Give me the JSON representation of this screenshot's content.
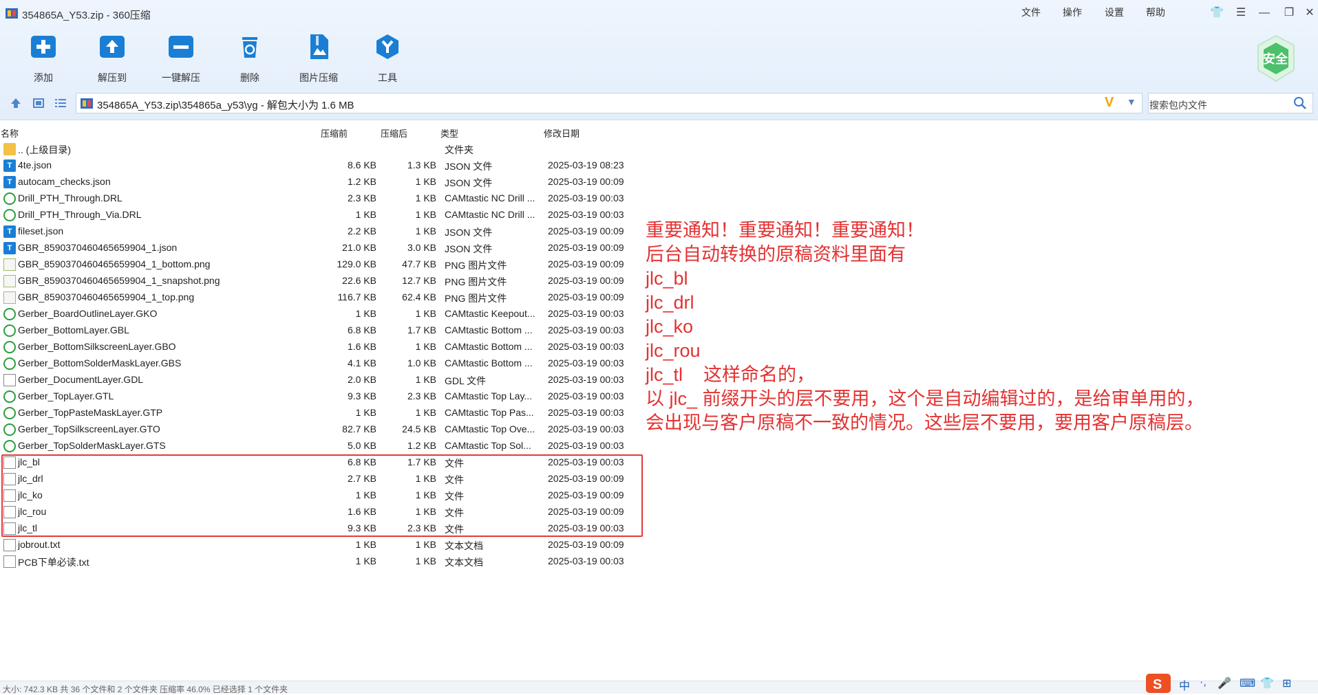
{
  "window": {
    "title": "354865A_Y53.zip - 360压缩",
    "menu": [
      "文件",
      "操作",
      "设置",
      "帮助"
    ]
  },
  "toolbar": {
    "items": [
      {
        "label": "添加",
        "icon": "add-icon"
      },
      {
        "label": "解压到",
        "icon": "extract-to-icon"
      },
      {
        "label": "一键解压",
        "icon": "one-click-extract-icon"
      },
      {
        "label": "删除",
        "icon": "delete-icon"
      },
      {
        "label": "图片压缩",
        "icon": "image-compress-icon"
      },
      {
        "label": "工具",
        "icon": "tools-icon"
      }
    ],
    "badge": "安全",
    "accent": "#1a7fd4"
  },
  "address": {
    "path": "354865A_Y53.zip\\354865a_y53\\yg - 解包大小为 1.6 MB",
    "search_placeholder": "搜索包内文件"
  },
  "columns": [
    "名称",
    "压缩前",
    "压缩后",
    "类型",
    "修改日期"
  ],
  "files": [
    {
      "name": ".. (上级目录)",
      "size": "",
      "packed": "",
      "type": "文件夹",
      "date": "",
      "icon": "folder"
    },
    {
      "name": "4te.json",
      "size": "8.6 KB",
      "packed": "1.3 KB",
      "type": "JSON 文件",
      "date": "2025-03-19 08:23",
      "icon": "json"
    },
    {
      "name": "autocam_checks.json",
      "size": "1.2 KB",
      "packed": "1 KB",
      "type": "JSON 文件",
      "date": "2025-03-19 00:09",
      "icon": "json"
    },
    {
      "name": "Drill_PTH_Through.DRL",
      "size": "2.3 KB",
      "packed": "1 KB",
      "type": "CAMtastic NC Drill ...",
      "date": "2025-03-19 00:03",
      "icon": "cam"
    },
    {
      "name": "Drill_PTH_Through_Via.DRL",
      "size": "1 KB",
      "packed": "1 KB",
      "type": "CAMtastic NC Drill ...",
      "date": "2025-03-19 00:03",
      "icon": "cam"
    },
    {
      "name": "fileset.json",
      "size": "2.2 KB",
      "packed": "1 KB",
      "type": "JSON 文件",
      "date": "2025-03-19 00:09",
      "icon": "json"
    },
    {
      "name": "GBR_8590370460465659904_1.json",
      "size": "21.0 KB",
      "packed": "3.0 KB",
      "type": "JSON 文件",
      "date": "2025-03-19 00:09",
      "icon": "json"
    },
    {
      "name": "GBR_8590370460465659904_1_bottom.png",
      "size": "129.0 KB",
      "packed": "47.7 KB",
      "type": "PNG 图片文件",
      "date": "2025-03-19 00:09",
      "icon": "png"
    },
    {
      "name": "GBR_8590370460465659904_1_snapshot.png",
      "size": "22.6 KB",
      "packed": "12.7 KB",
      "type": "PNG 图片文件",
      "date": "2025-03-19 00:09",
      "icon": "png"
    },
    {
      "name": "GBR_8590370460465659904_1_top.png",
      "size": "116.7 KB",
      "packed": "62.4 KB",
      "type": "PNG 图片文件",
      "date": "2025-03-19 00:09",
      "icon": "png"
    },
    {
      "name": "Gerber_BoardOutlineLayer.GKO",
      "size": "1 KB",
      "packed": "1 KB",
      "type": "CAMtastic Keepout...",
      "date": "2025-03-19 00:03",
      "icon": "cam"
    },
    {
      "name": "Gerber_BottomLayer.GBL",
      "size": "6.8 KB",
      "packed": "1.7 KB",
      "type": "CAMtastic Bottom ...",
      "date": "2025-03-19 00:03",
      "icon": "cam"
    },
    {
      "name": "Gerber_BottomSilkscreenLayer.GBO",
      "size": "1.6 KB",
      "packed": "1 KB",
      "type": "CAMtastic Bottom ...",
      "date": "2025-03-19 00:03",
      "icon": "cam"
    },
    {
      "name": "Gerber_BottomSolderMaskLayer.GBS",
      "size": "4.1 KB",
      "packed": "1.0 KB",
      "type": "CAMtastic Bottom ...",
      "date": "2025-03-19 00:03",
      "icon": "cam"
    },
    {
      "name": "Gerber_DocumentLayer.GDL",
      "size": "2.0 KB",
      "packed": "1 KB",
      "type": "GDL 文件",
      "date": "2025-03-19 00:03",
      "icon": "file"
    },
    {
      "name": "Gerber_TopLayer.GTL",
      "size": "9.3 KB",
      "packed": "2.3 KB",
      "type": "CAMtastic Top Lay...",
      "date": "2025-03-19 00:03",
      "icon": "cam"
    },
    {
      "name": "Gerber_TopPasteMaskLayer.GTP",
      "size": "1 KB",
      "packed": "1 KB",
      "type": "CAMtastic Top Pas...",
      "date": "2025-03-19 00:03",
      "icon": "cam"
    },
    {
      "name": "Gerber_TopSilkscreenLayer.GTO",
      "size": "82.7 KB",
      "packed": "24.5 KB",
      "type": "CAMtastic Top Ove...",
      "date": "2025-03-19 00:03",
      "icon": "cam"
    },
    {
      "name": "Gerber_TopSolderMaskLayer.GTS",
      "size": "5.0 KB",
      "packed": "1.2 KB",
      "type": "CAMtastic Top Sol...",
      "date": "2025-03-19 00:03",
      "icon": "cam"
    },
    {
      "name": "jlc_bl",
      "size": "6.8 KB",
      "packed": "1.7 KB",
      "type": "文件",
      "date": "2025-03-19 00:03",
      "icon": "file"
    },
    {
      "name": "jlc_drl",
      "size": "2.7 KB",
      "packed": "1 KB",
      "type": "文件",
      "date": "2025-03-19 00:09",
      "icon": "file"
    },
    {
      "name": "jlc_ko",
      "size": "1 KB",
      "packed": "1 KB",
      "type": "文件",
      "date": "2025-03-19 00:09",
      "icon": "file"
    },
    {
      "name": "jlc_rou",
      "size": "1.6 KB",
      "packed": "1 KB",
      "type": "文件",
      "date": "2025-03-19 00:09",
      "icon": "file"
    },
    {
      "name": "jlc_tl",
      "size": "9.3 KB",
      "packed": "2.3 KB",
      "type": "文件",
      "date": "2025-03-19 00:03",
      "icon": "file"
    },
    {
      "name": "jobrout.txt",
      "size": "1 KB",
      "packed": "1 KB",
      "type": "文本文档",
      "date": "2025-03-19 00:09",
      "icon": "txt"
    },
    {
      "name": "PCB下单必读.txt",
      "size": "1 KB",
      "packed": "1 KB",
      "type": "文本文档",
      "date": "2025-03-19 00:03",
      "icon": "txt"
    }
  ],
  "notice": {
    "lines": [
      "重要通知！重要通知！重要通知！",
      "后台自动转换的原稿资料里面有",
      "jlc_bl",
      "jlc_drl",
      "jlc_ko",
      "jlc_rou",
      "jlc_tl    这样命名的，",
      "以 jlc_ 前缀开头的层不要用，这个是自动编辑过的，是给审单用的，",
      "会出现与客户原稿不一致的情况。这些层不要用，要用客户原稿层。"
    ],
    "color": "#e33232"
  },
  "status": {
    "text": "大小: 742.3 KB 共 36 个文件和 2 个文件夹 压缩率 46.0% 已经选择 1 个文件夹"
  },
  "ime": {
    "items": [
      "中",
      "·,",
      "🎤",
      "⌨",
      "👕",
      "⊞"
    ]
  }
}
